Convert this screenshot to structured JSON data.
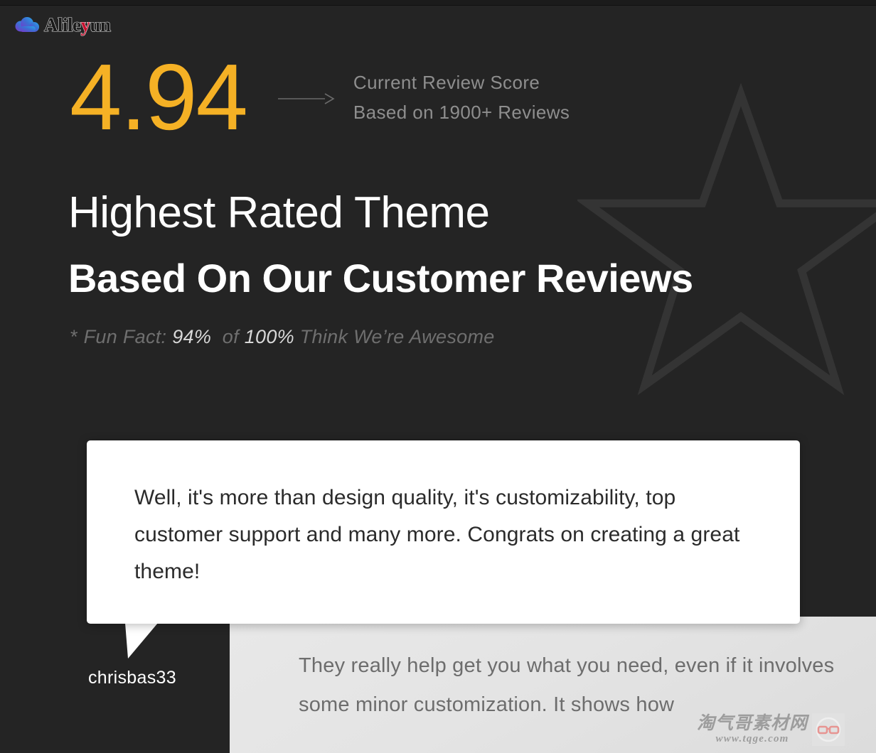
{
  "brand": {
    "logo_icon": "cloud-icon",
    "name_part1": "Alile",
    "name_highlight": "y",
    "name_part2": "un",
    "highlight_color": "#c8102e"
  },
  "score": {
    "value": "4.94",
    "value_color": "#f5b125",
    "arrow_icon": "arrow-right-icon",
    "caption_line1": "Current Review  Score",
    "caption_line2": "Based on 1900+ Reviews"
  },
  "headline": {
    "line1": "Highest Rated Theme",
    "line2": "Based On Our Customer Reviews"
  },
  "fun_fact": {
    "marker": "*",
    "label": "Fun Fact:",
    "percent": "94%",
    "connector": "of",
    "total": "100%",
    "suffix": "Think We’re Awesome"
  },
  "background": {
    "star_icon": "star-outline-icon"
  },
  "testimonial_primary": {
    "quote": "Well, it's more than design quality, it's customizability, top customer support and many more. Congrats on creating a great theme!",
    "author": "chrisbas33",
    "tail_icon": "speech-bubble-tail-icon"
  },
  "testimonial_secondary": {
    "quote": "They really help get you what you need, even if it involves some minor customization. It shows how"
  },
  "watermark": {
    "site_name_cn": "淘气哥素材网",
    "site_url": "www.tqge.com",
    "badge_icon": "glasses-face-icon"
  }
}
